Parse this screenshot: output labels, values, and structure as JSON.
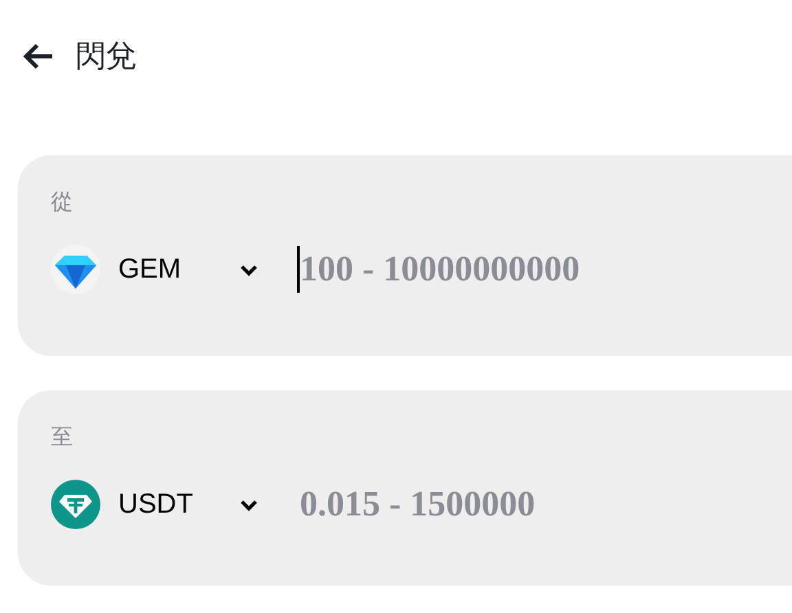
{
  "header": {
    "title": "閃兌"
  },
  "panels": [
    {
      "label": "從",
      "token": {
        "kind": "gem",
        "symbol": "GEM"
      },
      "amount": {
        "placeholder": "100 - 10000000000",
        "focused": true
      }
    },
    {
      "label": "至",
      "token": {
        "kind": "usdt",
        "symbol": "USDT"
      },
      "amount": {
        "placeholder": "0.015 - 1500000",
        "focused": false
      }
    }
  ]
}
